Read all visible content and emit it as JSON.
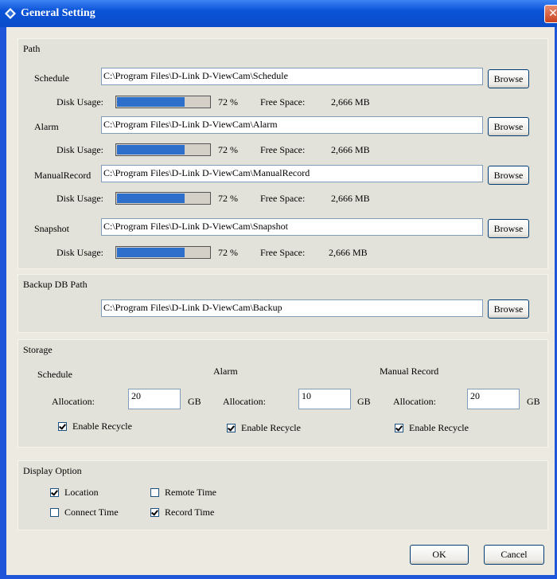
{
  "window": {
    "title": "General Setting",
    "close_glyph": "✕"
  },
  "path": {
    "title": "Path",
    "disk_usage_label": "Disk Usage:",
    "free_space_label": "Free Space:",
    "browse_label": "Browse",
    "rows": [
      {
        "label": "Schedule",
        "value": "C:\\Program Files\\D-Link D-ViewCam\\Schedule",
        "usage_percent": 72,
        "usage_text": "72 %",
        "free_space": "2,666 MB"
      },
      {
        "label": "Alarm",
        "value": "C:\\Program Files\\D-Link D-ViewCam\\Alarm",
        "usage_percent": 72,
        "usage_text": "72 %",
        "free_space": "2,666 MB"
      },
      {
        "label": "ManualRecord",
        "value": "C:\\Program Files\\D-Link D-ViewCam\\ManualRecord",
        "usage_percent": 72,
        "usage_text": "72 %",
        "free_space": "2,666 MB"
      },
      {
        "label": "Snapshot",
        "value": "C:\\Program Files\\D-Link D-ViewCam\\Snapshot",
        "usage_percent": 72,
        "usage_text": "72 %",
        "free_space": "2,666  MB"
      }
    ]
  },
  "backup": {
    "title": "Backup DB Path",
    "value": "C:\\Program Files\\D-Link D-ViewCam\\Backup",
    "browse_label": "Browse"
  },
  "storage": {
    "title": "Storage",
    "allocation_label": "Allocation:",
    "unit": "GB",
    "recycle_label": "Enable Recycle",
    "columns": [
      {
        "label": "Schedule",
        "allocation": "20",
        "recycle": true
      },
      {
        "label": "Alarm",
        "allocation": "10",
        "recycle": true
      },
      {
        "label": "Manual Record",
        "allocation": "20",
        "recycle": true
      }
    ]
  },
  "display": {
    "title": "Display Option",
    "options": [
      {
        "label": "Location",
        "checked": true
      },
      {
        "label": "Remote Time",
        "checked": false
      },
      {
        "label": "Connect Time",
        "checked": false
      },
      {
        "label": "Record Time",
        "checked": true
      }
    ]
  },
  "footer": {
    "ok_label": "OK",
    "cancel_label": "Cancel"
  },
  "colors": {
    "titlebar": "#0a53d8",
    "usage_fill": "#2f6fcc",
    "dialog_bg": "#eceae1"
  }
}
